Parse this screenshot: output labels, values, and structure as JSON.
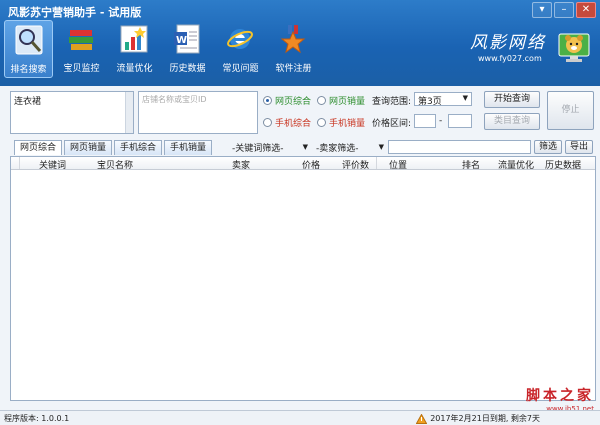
{
  "window": {
    "title": "风影苏宁营销助手 - 试用版"
  },
  "toolbar": {
    "items": [
      {
        "label": "排名搜索",
        "icon": "magnifier-icon",
        "active": true
      },
      {
        "label": "宝贝监控",
        "icon": "books-icon",
        "active": false
      },
      {
        "label": "流量优化",
        "icon": "bar-chart-icon",
        "active": false
      },
      {
        "label": "历史数据",
        "icon": "word-document-icon",
        "active": false
      },
      {
        "label": "常见问题",
        "icon": "ie-browser-icon",
        "active": false
      },
      {
        "label": "软件注册",
        "icon": "star-medal-icon",
        "active": false
      }
    ]
  },
  "brand": {
    "name": "风影网络",
    "url": "www.fy027.com"
  },
  "search": {
    "keyword_value": "连衣裙",
    "shop_placeholder": "店铺名称或宝贝ID",
    "radios": [
      {
        "label": "网页综合",
        "checked": true,
        "color": "green"
      },
      {
        "label": "网页销量",
        "checked": false,
        "color": "green"
      },
      {
        "label": "手机综合",
        "checked": false,
        "color": "red"
      },
      {
        "label": "手机销量",
        "checked": false,
        "color": "red"
      }
    ],
    "range_label": "查询范围:",
    "range_value": "第3页",
    "price_label": "价格区间:",
    "price_sep": "-",
    "start_button": "开始查询",
    "export_query_button": "类目查询",
    "stop_button": "停止"
  },
  "tabs": [
    "网页综合",
    "网页销量",
    "手机综合",
    "手机销量"
  ],
  "filters": {
    "keyword_filter": "-关键词筛选-",
    "seller_filter": "-卖家筛选-",
    "filter_button": "筛选",
    "export_button": "导出"
  },
  "table": {
    "columns": [
      "关键词",
      "宝贝名称",
      "卖家",
      "价格",
      "评价数",
      "位置",
      "排名",
      "流量优化",
      "历史数据"
    ]
  },
  "status": {
    "version": "程序版本: 1.0.0.1",
    "expiry": "2017年2月21日到期, 剩余7天"
  },
  "watermark": {
    "big": "脚本之家",
    "small": "www.jb51.net"
  },
  "colors": {
    "titlebar": "#1a63b3",
    "accent_green": "#2a8c2a",
    "accent_red": "#c8321e",
    "watermark_red": "#c9252a"
  }
}
